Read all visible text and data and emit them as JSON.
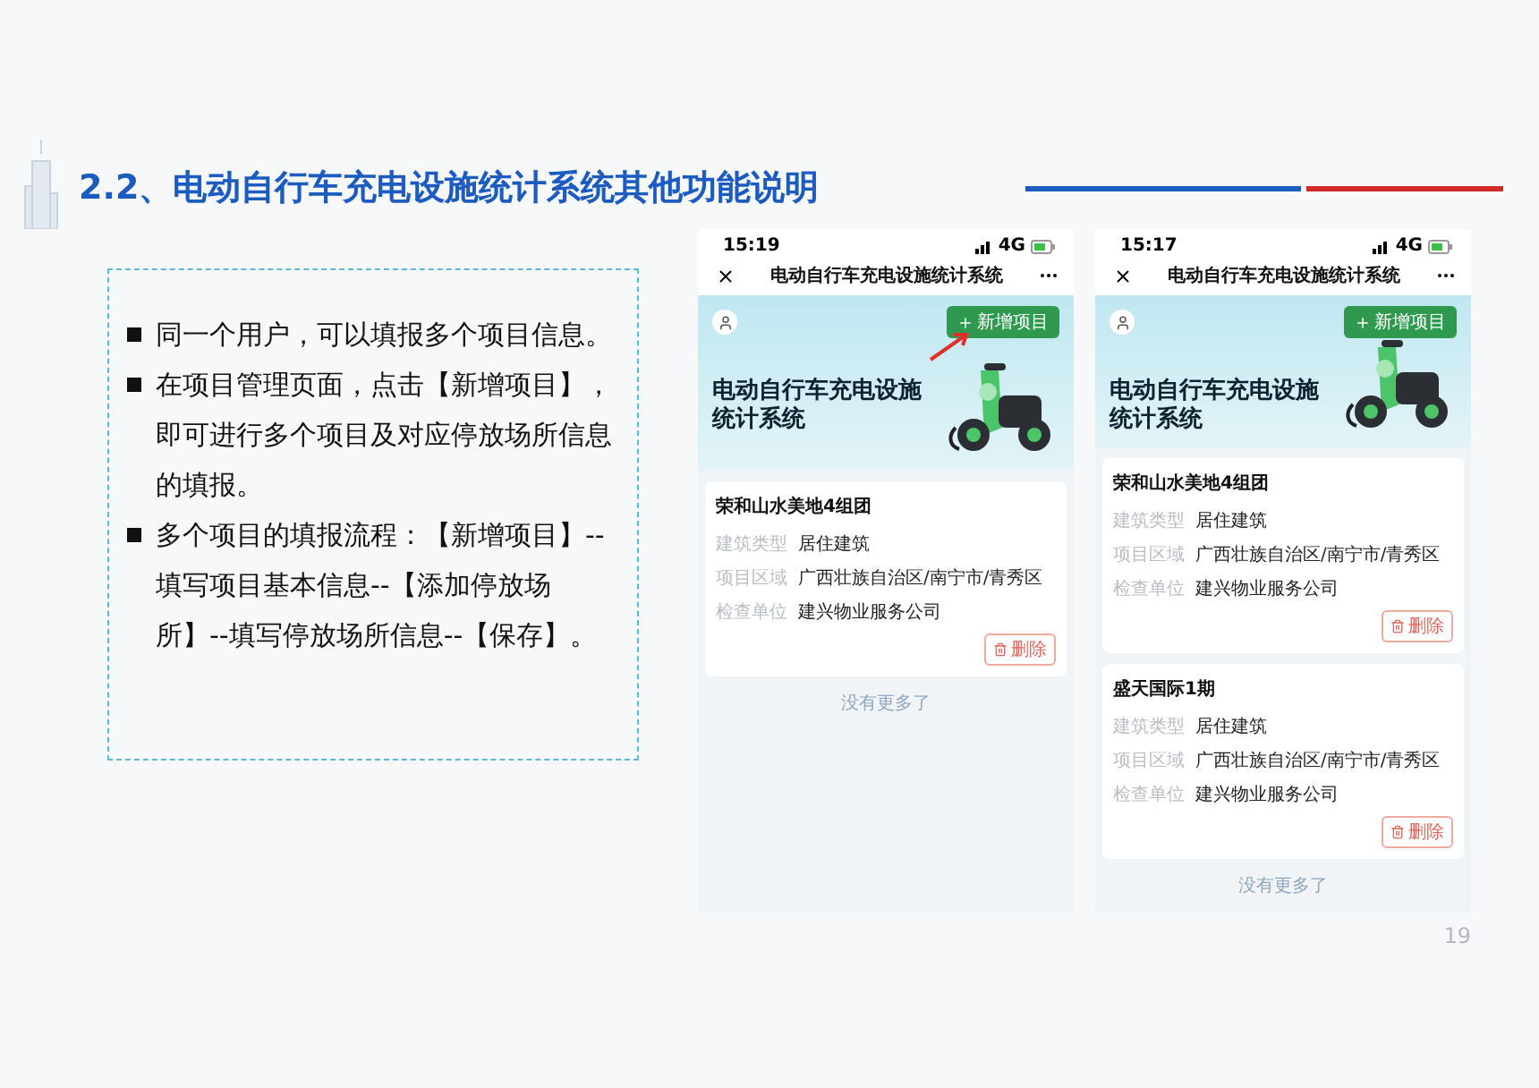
{
  "slide": {
    "title": "2.2、电动自行车充电设施统计系统其他功能说明",
    "page_number": "19"
  },
  "bullets": [
    {
      "text": "同一个用户，可以填报多个项目信息。"
    },
    {
      "text": "在项目管理页面，点击【新增项目】，即可进行多个项目及对应停放场所信息的填报。"
    },
    {
      "text": "多个项目的填报流程：【新增项目】--填写项目基本信息--【添加停放场所】--填写停放场所信息--【保存】。"
    }
  ],
  "phones": [
    {
      "time": "15:19",
      "network": "4G",
      "nav_title": "电动自行车充电设施统计系统",
      "add_button": "新增项目",
      "pointer_arrow": true,
      "banner_title": "电动自行车充电设施统计系统",
      "footer": "没有更多了",
      "projects": [
        {
          "name": "荣和山水美地4组团",
          "delete_button": "删除",
          "fields": [
            {
              "label": "建筑类型",
              "value": "居住建筑"
            },
            {
              "label": "项目区域",
              "value": "广西壮族自治区/南宁市/青秀区"
            },
            {
              "label": "检查单位",
              "value": "建兴物业服务公司"
            }
          ]
        }
      ]
    },
    {
      "time": "15:17",
      "network": "4G",
      "nav_title": "电动自行车充电设施统计系统",
      "add_button": "新增项目",
      "pointer_arrow": false,
      "banner_title": "电动自行车充电设施统计系统",
      "footer": "没有更多了",
      "projects": [
        {
          "name": "荣和山水美地4组团",
          "delete_button": "删除",
          "fields": [
            {
              "label": "建筑类型",
              "value": "居住建筑"
            },
            {
              "label": "项目区域",
              "value": "广西壮族自治区/南宁市/青秀区"
            },
            {
              "label": "检查单位",
              "value": "建兴物业服务公司"
            }
          ]
        },
        {
          "name": "盛天国际1期",
          "delete_button": "删除",
          "fields": [
            {
              "label": "建筑类型",
              "value": "居住建筑"
            },
            {
              "label": "项目区域",
              "value": "广西壮族自治区/南宁市/青秀区"
            },
            {
              "label": "检查单位",
              "value": "建兴物业服务公司"
            }
          ]
        }
      ]
    }
  ]
}
